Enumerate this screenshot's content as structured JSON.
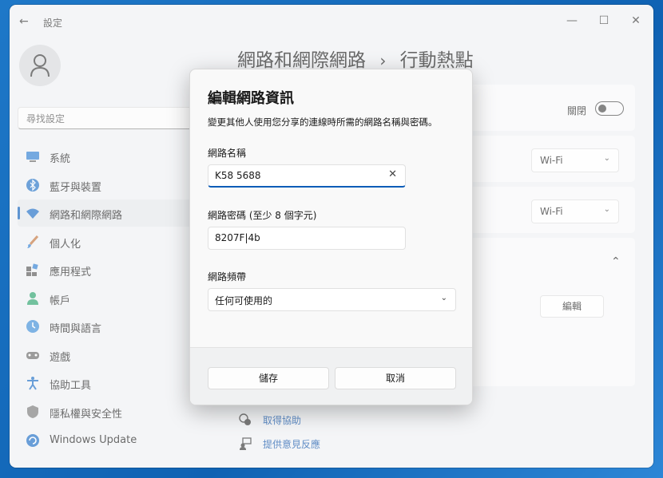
{
  "app": {
    "title": "設定"
  },
  "search": {
    "placeholder": "尋找設定"
  },
  "sidebar": {
    "items": [
      {
        "label": "系統",
        "icon": "monitor-icon"
      },
      {
        "label": "藍牙與裝置",
        "icon": "bluetooth-icon"
      },
      {
        "label": "網路和網際網路",
        "icon": "wifi-icon",
        "active": true
      },
      {
        "label": "個人化",
        "icon": "brush-icon"
      },
      {
        "label": "應用程式",
        "icon": "apps-icon"
      },
      {
        "label": "帳戶",
        "icon": "person-icon"
      },
      {
        "label": "時間與語言",
        "icon": "clock-globe-icon"
      },
      {
        "label": "遊戲",
        "icon": "gamepad-icon"
      },
      {
        "label": "協助工具",
        "icon": "accessibility-icon"
      },
      {
        "label": "隱私權與安全性",
        "icon": "shield-icon"
      },
      {
        "label": "Windows Update",
        "icon": "update-icon"
      }
    ]
  },
  "main": {
    "breadcrumb_parent": "網路和網際網路",
    "breadcrumb_sep": "›",
    "breadcrumb_current": "行動熱點",
    "toggle_label": "關閉",
    "dropdown1": "Wi-Fi",
    "dropdown2": "Wi-Fi",
    "edit_button": "編輯",
    "help_link": "取得協助",
    "feedback_link": "提供意見反應"
  },
  "dialog": {
    "title": "編輯網路資訊",
    "description": "變更其他人使用您分享的連線時所需的網路名稱與密碼。",
    "name_label": "網路名稱",
    "name_value": "K58 5688",
    "password_label": "網路密碼 (至少 8 個字元)",
    "password_value": "8207F|4b",
    "band_label": "網路頻帶",
    "band_value": "任何可使用的",
    "save_button": "儲存",
    "cancel_button": "取消"
  },
  "colors": {
    "accent": "#0a5cb8",
    "window_bg": "#eef0f3",
    "desktop": "#1e78c8"
  }
}
